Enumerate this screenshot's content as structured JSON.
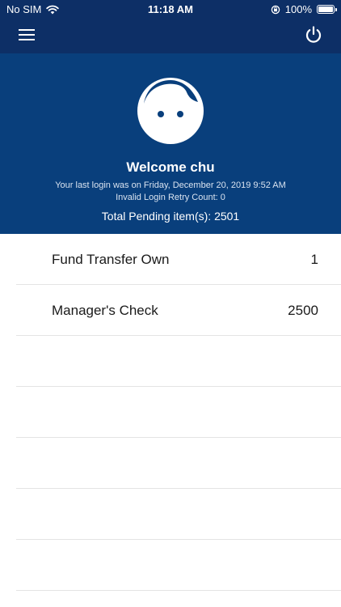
{
  "status_bar": {
    "carrier": "No SIM",
    "time": "11:18 AM",
    "battery": "100%"
  },
  "nav": {
    "menu_icon": "hamburger-menu-icon",
    "power_icon": "power-icon"
  },
  "profile": {
    "avatar_icon": "face-avatar-icon",
    "welcome": "Welcome chu",
    "last_login": "Your last login was on Friday, December 20, 2019 9:52 AM",
    "retry_count": "Invalid Login Retry Count: 0",
    "total_pending": "Total Pending item(s): 2501"
  },
  "items": [
    {
      "label": "Fund Transfer Own",
      "count": "1"
    },
    {
      "label": "Manager's Check",
      "count": "2500"
    },
    {
      "label": "",
      "count": ""
    },
    {
      "label": "",
      "count": ""
    },
    {
      "label": "",
      "count": ""
    },
    {
      "label": "",
      "count": ""
    },
    {
      "label": "",
      "count": ""
    }
  ],
  "colors": {
    "nav_bg": "#0d2f66",
    "header_bg": "#093f7c"
  }
}
